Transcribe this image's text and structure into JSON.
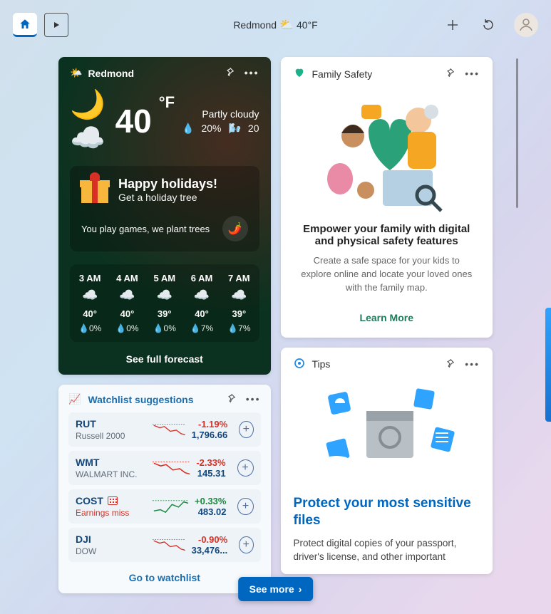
{
  "top": {
    "location": "Redmond",
    "temp": "40°F"
  },
  "weather": {
    "location": "Redmond",
    "temp": "40",
    "unit": "°F",
    "summary": "Partly cloudy",
    "precip": "20%",
    "aqi": "20",
    "promo_title": "Happy holidays!",
    "promo_sub": "Get a holiday tree",
    "promo_footer": "You play games, we plant trees",
    "see_full": "See full forecast",
    "hours": [
      {
        "t": "3 AM",
        "temp": "40°",
        "p": "0%"
      },
      {
        "t": "4 AM",
        "temp": "40°",
        "p": "0%"
      },
      {
        "t": "5 AM",
        "temp": "39°",
        "p": "0%"
      },
      {
        "t": "6 AM",
        "temp": "40°",
        "p": "7%"
      },
      {
        "t": "7 AM",
        "temp": "39°",
        "p": "7%"
      }
    ]
  },
  "family": {
    "header": "Family Safety",
    "title": "Empower your family with digital and physical safety features",
    "sub": "Create a safe space for your kids to explore online and locate your loved ones with the family map.",
    "link": "Learn More"
  },
  "watchlist": {
    "header": "Watchlist suggestions",
    "go": "Go to watchlist",
    "rows": [
      {
        "sym": "RUT",
        "name": "Russell 2000",
        "pct": "-1.19%",
        "dir": "down",
        "price": "1,796.66",
        "earn": false
      },
      {
        "sym": "WMT",
        "name": "WALMART INC.",
        "pct": "-2.33%",
        "dir": "down",
        "price": "145.31",
        "earn": false
      },
      {
        "sym": "COST",
        "name": "Earnings miss",
        "pct": "+0.33%",
        "dir": "up",
        "price": "483.02",
        "earn": true
      },
      {
        "sym": "DJI",
        "name": "DOW",
        "pct": "-0.90%",
        "dir": "down",
        "price": "33,476...",
        "earn": false
      }
    ]
  },
  "tips": {
    "header": "Tips",
    "title": "Protect your most sensitive files",
    "sub": "Protect digital copies of your passport, driver's license, and other important"
  },
  "see_more": "See more"
}
